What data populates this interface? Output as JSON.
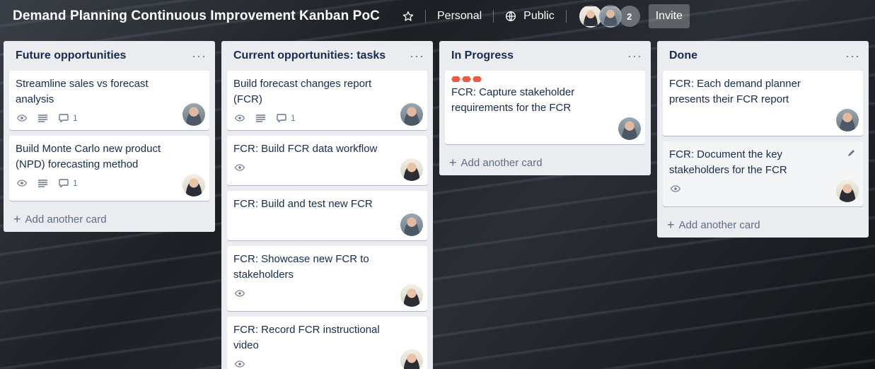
{
  "header": {
    "board_title": "Demand Planning Continuous Improvement Kanban PoC",
    "team": "Personal",
    "visibility": "Public",
    "member_count_badge": "2",
    "invite_label": "Invite"
  },
  "lists": [
    {
      "title": "Future opportunities",
      "menu": "···",
      "add_card": "Add another card",
      "cards": [
        {
          "title": "Streamline sales vs forecast analysis",
          "comments": "1"
        },
        {
          "title": "Build Monte Carlo new product (NPD) forecasting method",
          "comments": "1"
        }
      ]
    },
    {
      "title": "Current opportunities: tasks",
      "menu": "···",
      "cards": [
        {
          "title": "Build forecast changes report (FCR)",
          "comments": "1"
        },
        {
          "title": "FCR: Build FCR data workflow"
        },
        {
          "title": "FCR: Build and test new FCR"
        },
        {
          "title": "FCR: Showcase new FCR to stakeholders"
        },
        {
          "title": "FCR: Record FCR instructional video"
        }
      ]
    },
    {
      "title": "In Progress",
      "menu": "···",
      "add_card": "Add another card",
      "cards": [
        {
          "title": "FCR: Capture stakeholder requirements for the FCR"
        }
      ]
    },
    {
      "title": "Done",
      "menu": "···",
      "add_card": "Add another card",
      "cards": [
        {
          "title": "FCR: Each demand planner presents their FCR report"
        },
        {
          "title": "FCR: Document the key stakeholders for the FCR"
        }
      ]
    }
  ],
  "icons": {
    "star": "star-icon",
    "globe": "globe-icon",
    "watch": "eye-icon",
    "description": "description-icon",
    "comment": "comment-icon",
    "edit": "pencil-icon",
    "add": "plus-icon"
  },
  "colors": {
    "label_red": "#eb5a46",
    "list_bg": "#ebecf0",
    "title_text": "#172b4d"
  }
}
